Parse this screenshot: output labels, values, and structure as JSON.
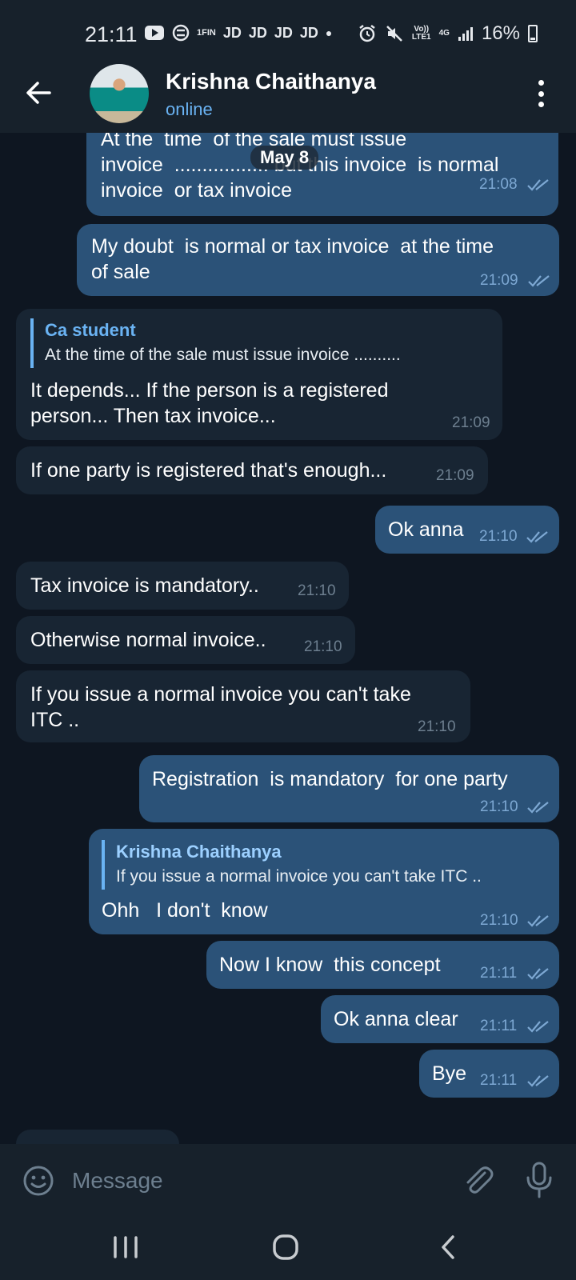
{
  "status_bar": {
    "time": "21:11",
    "notif_items": [
      "1FIN",
      "JD",
      "JD",
      "JD",
      "JD"
    ],
    "network": "4G",
    "volte": "Vo))",
    "lte": "LTE1",
    "battery": "16%"
  },
  "header": {
    "contact_name": "Krishna Chaithanya",
    "status": "online"
  },
  "chat": {
    "date_label": "May 8",
    "messages": [
      {
        "dir": "out",
        "text": "At the  time  of the sale must issue\ninvoice  ................. but this invoice  is normal\ninvoice  or tax invoice",
        "time": "21:08"
      },
      {
        "dir": "out",
        "text": "My doubt  is normal or tax invoice  at the time\nof sale",
        "time": "21:09"
      },
      {
        "dir": "in",
        "reply_name": "Ca student",
        "reply_text": "At the  time  of the sale must issue  invoice  ..........",
        "text": "It depends... If the person is a registered\nperson... Then tax invoice...",
        "time": "21:09"
      },
      {
        "dir": "in",
        "text": "If one party is registered that's enough...",
        "time": "21:09"
      },
      {
        "dir": "out",
        "text": "Ok anna",
        "time": "21:10"
      },
      {
        "dir": "in",
        "text": "Tax invoice is mandatory..",
        "time": "21:10"
      },
      {
        "dir": "in",
        "text": "Otherwise normal invoice..",
        "time": "21:10"
      },
      {
        "dir": "in",
        "text": "If you issue a normal invoice you can't take\nITC ..",
        "time": "21:10"
      },
      {
        "dir": "out",
        "text": "Registration  is mandatory  for one party",
        "time": "21:10"
      },
      {
        "dir": "out",
        "reply_name": "Krishna Chaithanya",
        "reply_text": "If you issue a normal invoice you can't take ITC ..",
        "text": "Ohh   I don't  know",
        "time": "21:10"
      },
      {
        "dir": "out",
        "text": "Now I know  this concept",
        "time": "21:11"
      },
      {
        "dir": "out",
        "text": "Ok anna clear",
        "time": "21:11"
      },
      {
        "dir": "out",
        "text": "Bye",
        "time": "21:11"
      }
    ]
  },
  "input": {
    "placeholder": "Message"
  },
  "colors": {
    "background": "#0e1621",
    "bar": "#17212b",
    "outgoing_bubble": "#2b5278",
    "incoming_bubble": "#182533",
    "accent": "#6ab3f3"
  }
}
